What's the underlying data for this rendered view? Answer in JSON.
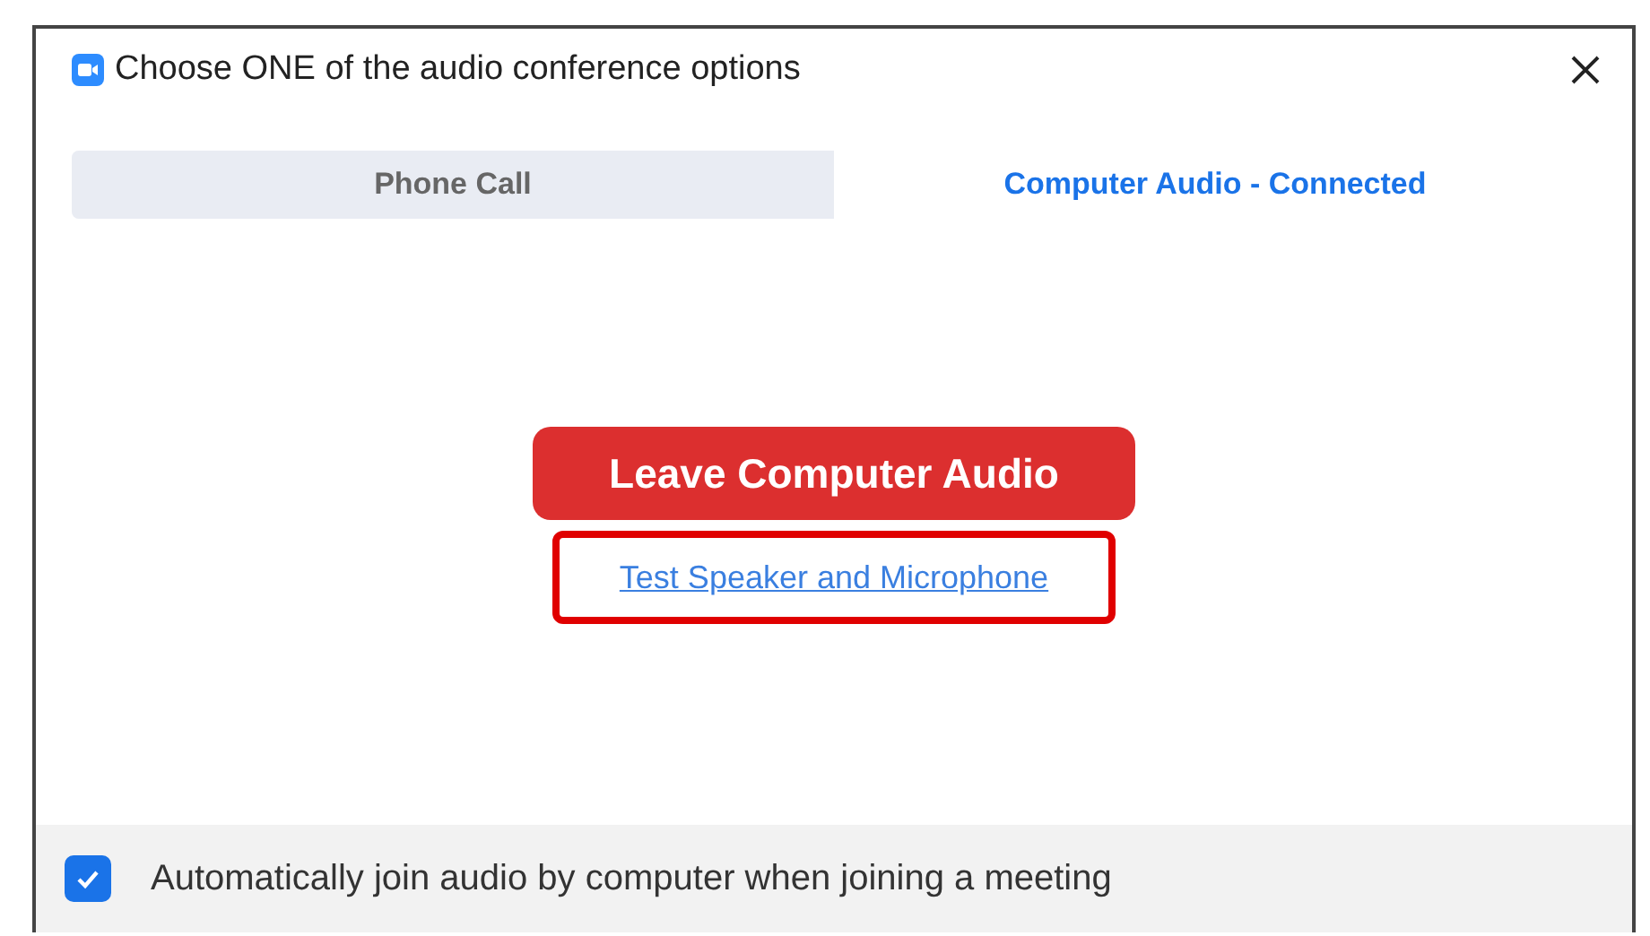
{
  "window": {
    "title": "Choose ONE of the audio conference options"
  },
  "tabs": [
    {
      "label": "Phone Call",
      "selected": false
    },
    {
      "label": "Computer Audio - Connected",
      "selected": true
    }
  ],
  "primary_button": {
    "label": "Leave Computer Audio"
  },
  "test_link": {
    "label": "Test Speaker and Microphone",
    "highlighted": true
  },
  "footer": {
    "checkbox": {
      "label": "Automatically join audio by computer when joining a meeting",
      "checked": true
    }
  }
}
